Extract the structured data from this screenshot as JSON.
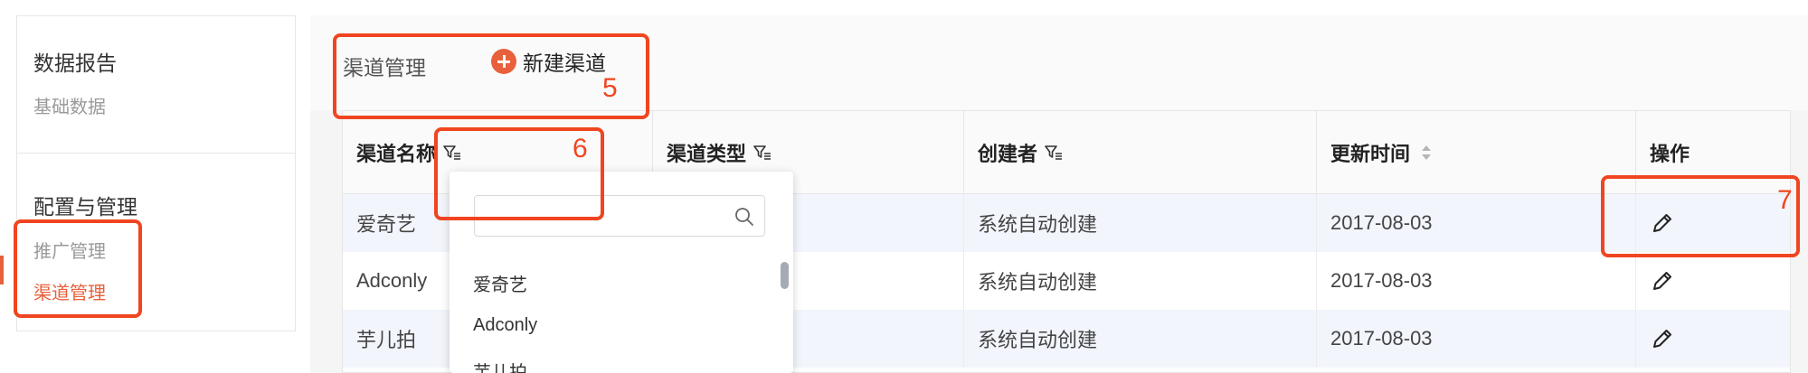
{
  "sidebar": {
    "group1": {
      "heading": "数据报告",
      "items": [
        {
          "label": "基础数据"
        }
      ]
    },
    "group2": {
      "heading": "配置与管理",
      "items": [
        {
          "label": "推广管理"
        },
        {
          "label": "渠道管理"
        }
      ]
    }
  },
  "main": {
    "title": "渠道管理",
    "new_button_label": "新建渠道"
  },
  "table": {
    "columns": [
      {
        "label": "渠道名称"
      },
      {
        "label": "渠道类型"
      },
      {
        "label": "创建者"
      },
      {
        "label": "更新时间"
      },
      {
        "label": "操作"
      }
    ],
    "rows": [
      {
        "name": "爱奇艺",
        "creator": "系统自动创建",
        "updated": "2017-08-03"
      },
      {
        "name": "Adconly",
        "creator": "系统自动创建",
        "updated": "2017-08-03"
      },
      {
        "name": "芋儿拍",
        "creator": "系统自动创建",
        "updated": "2017-08-03"
      }
    ]
  },
  "filter_dropdown": {
    "search_value": "",
    "options": [
      {
        "label": "爱奇艺"
      },
      {
        "label": "Adconly"
      },
      {
        "label": "芋儿拍"
      }
    ]
  },
  "annotations": [
    {
      "label": "5"
    },
    {
      "label": "6"
    },
    {
      "label": "7"
    }
  ],
  "colors": {
    "accent": "#e8613c",
    "annotation": "#f04520",
    "alt_row": "#f2f5fb"
  },
  "icons": {
    "new": "plus-circle-icon",
    "filter": "filter-icon",
    "sort": "sort-icon",
    "edit": "pencil-icon",
    "search": "search-icon"
  }
}
